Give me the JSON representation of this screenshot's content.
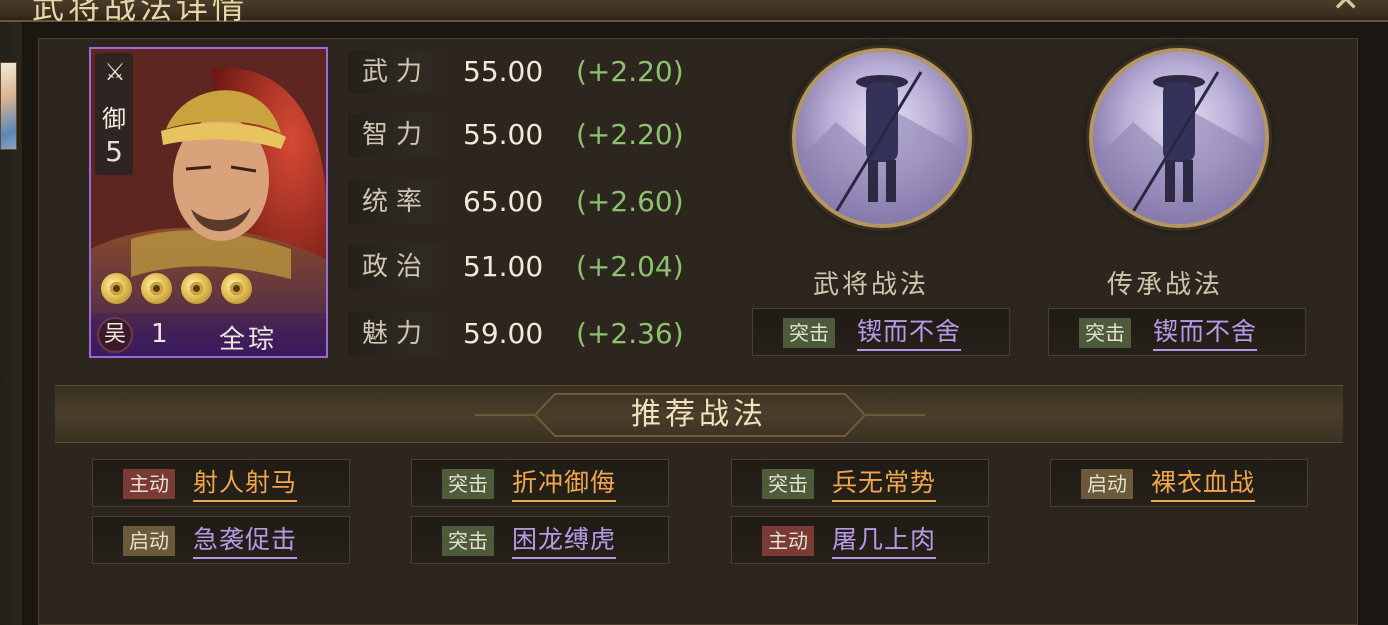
{
  "header": {
    "title": "武将战法详情"
  },
  "general": {
    "faction": "吴",
    "level": "1",
    "name": "全琮",
    "badge_char": "御",
    "badge_num": "5",
    "stars": 4
  },
  "stats": [
    {
      "label": "武力",
      "value": "55.00",
      "bonus": "(+2.20)"
    },
    {
      "label": "智力",
      "value": "55.00",
      "bonus": "(+2.20)"
    },
    {
      "label": "统率",
      "value": "65.00",
      "bonus": "(+2.60)"
    },
    {
      "label": "政治",
      "value": "51.00",
      "bonus": "(+2.04)"
    },
    {
      "label": "魅力",
      "value": "59.00",
      "bonus": "(+2.36)"
    }
  ],
  "skills": {
    "own": {
      "title": "武将战法",
      "tag": "突击",
      "name": "锲而不舍"
    },
    "inherit": {
      "title": "传承战法",
      "tag": "突击",
      "name": "锲而不舍"
    }
  },
  "recommend": {
    "title": "推荐战法",
    "items": [
      {
        "tag": "主动",
        "name": "射人射马"
      },
      {
        "tag": "突击",
        "name": "折冲御侮"
      },
      {
        "tag": "突击",
        "name": "兵无常势"
      },
      {
        "tag": "启动",
        "name": "裸衣血战"
      },
      {
        "tag": "启动",
        "name": "急袭促击"
      },
      {
        "tag": "突击",
        "name": "困龙缚虎"
      },
      {
        "tag": "主动",
        "name": "屠几上肉"
      }
    ]
  },
  "colors": {
    "rarity_border": "#9b6ad6",
    "bonus": "#8cc26e",
    "purple_skill": "#b79ae6",
    "orange_skill": "#f0a64a"
  }
}
